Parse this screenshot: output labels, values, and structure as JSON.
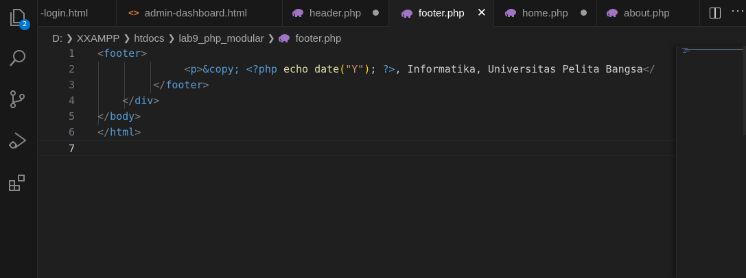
{
  "tabs": [
    {
      "label": "-login.html",
      "icon": "html-icon",
      "state": "normal"
    },
    {
      "label": "admin-dashboard.html",
      "icon": "html-icon",
      "state": "normal"
    },
    {
      "label": "header.php",
      "icon": "php-elephant-icon",
      "state": "modified"
    },
    {
      "label": "footer.php",
      "icon": "php-elephant-icon",
      "state": "active"
    },
    {
      "label": "home.php",
      "icon": "php-elephant-icon",
      "state": "modified"
    },
    {
      "label": "about.php",
      "icon": "php-elephant-icon",
      "state": "normal"
    }
  ],
  "activity_badge": "2",
  "breadcrumb": [
    "D:",
    "XXAMPP",
    "htdocs",
    "lab9_php_modular",
    "footer.php"
  ],
  "colors": {
    "accent": "#0078d4",
    "php_icon": "#a074c4",
    "html_icon": "#e37933"
  },
  "editor": {
    "current_line": 7,
    "lines": [
      {
        "num": "1"
      },
      {
        "num": "2",
        "text_after": ", Informatika, Universitas Pelita Bangsa"
      },
      {
        "num": "3"
      },
      {
        "num": "4"
      },
      {
        "num": "5"
      },
      {
        "num": "6"
      },
      {
        "num": "7"
      }
    ]
  }
}
